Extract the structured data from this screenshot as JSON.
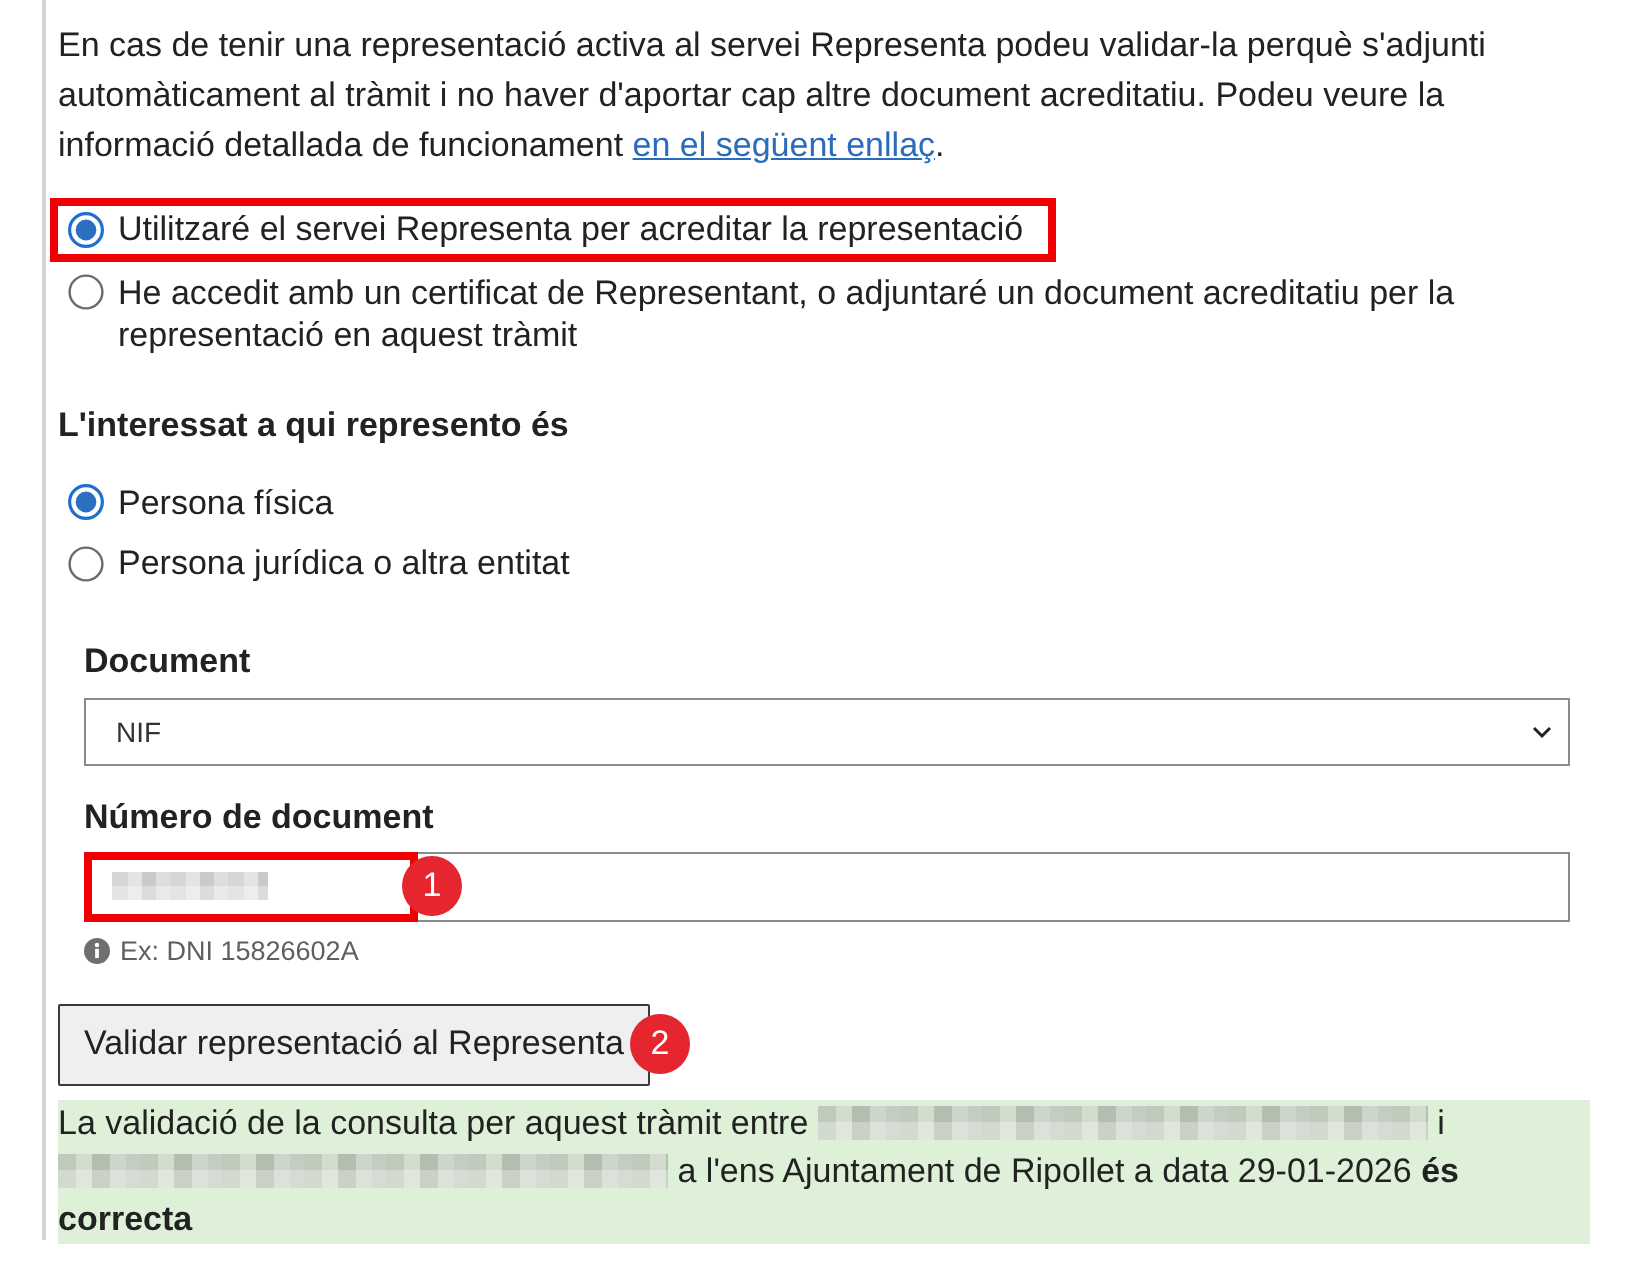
{
  "intro": {
    "text": "En cas de tenir una representació activa al servei Representa podeu validar-la perquè s'adjunti automàticament al tràmit i no haver d'aportar cap altre document acreditatiu. Podeu veure la informació detallada de funcionament",
    "link": "en el següent enllaç",
    "after": "."
  },
  "representation_mode": {
    "options": [
      {
        "label": "Utilitzaré el servei Representa per acreditar la representació",
        "selected": true,
        "highlighted": true
      },
      {
        "label": "He accedit amb un certificat de Representant, o adjuntaré un document acreditatiu per la representació en aquest tràmit",
        "selected": false,
        "highlighted": false
      }
    ]
  },
  "represented_party": {
    "heading": "L'interessat a qui represento és",
    "options": [
      {
        "label": "Persona física",
        "selected": true
      },
      {
        "label": "Persona jurídica o altra entitat",
        "selected": false
      }
    ]
  },
  "document_type": {
    "label": "Document",
    "value": "NIF"
  },
  "document_number": {
    "label": "Número de document",
    "value_redacted": true,
    "hint": "Ex: DNI 15826602A",
    "annotation": "1"
  },
  "validate_button": {
    "label": "Validar representació al Representa",
    "annotation": "2"
  },
  "result": {
    "parts": [
      {
        "kind": "text",
        "text": "La validació de la consulta per aquest tràmit entre",
        "bold": false
      },
      {
        "kind": "redacted"
      },
      {
        "kind": "text",
        "text": "i",
        "bold": false
      },
      {
        "kind": "redacted"
      },
      {
        "kind": "text",
        "text": "a l'ens Ajuntament de Ripollet a data 29-01-2026 **és**",
        "bold": false
      },
      {
        "kind": "text",
        "text": "correcta",
        "bold": true
      }
    ]
  }
}
